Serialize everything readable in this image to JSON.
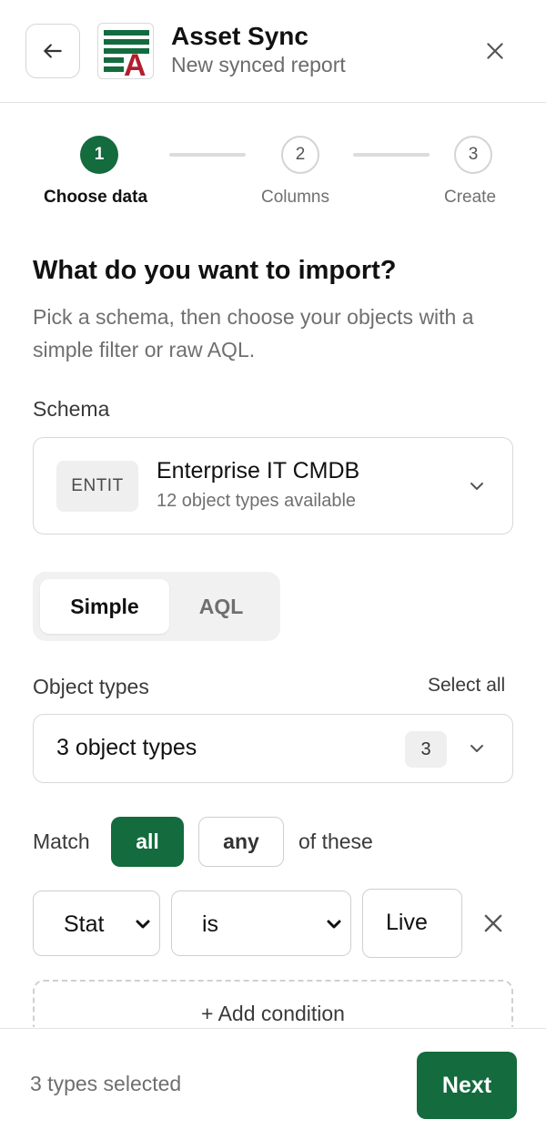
{
  "header": {
    "title": "Asset Sync",
    "subtitle": "New synced report",
    "back_icon": "arrow-left-icon",
    "close_icon": "close-icon",
    "logo_letter": "A"
  },
  "steps": [
    {
      "number": "1",
      "label": "Choose data",
      "state": "active"
    },
    {
      "number": "2",
      "label": "Columns",
      "state": "todo"
    },
    {
      "number": "3",
      "label": "Create",
      "state": "todo"
    }
  ],
  "main": {
    "heading": "What do you want to import?",
    "description": "Pick a schema, then choose your objects with a simple filter or raw AQL."
  },
  "schema": {
    "label": "Schema",
    "badge": "ENTIT",
    "name": "Enterprise IT CMDB",
    "description": "12 object types available"
  },
  "mode": {
    "options": [
      "Simple",
      "AQL"
    ],
    "selected": "Simple"
  },
  "object_types": {
    "label": "Object types",
    "select_all": "Select all",
    "value": "3 object types",
    "count": "3"
  },
  "match": {
    "prefix": "Match",
    "options": [
      "all",
      "any"
    ],
    "selected": "all",
    "suffix": "of these"
  },
  "condition": {
    "field": "Stat",
    "operator": "is",
    "value": "Live"
  },
  "add_condition": "+ Add condition",
  "footer": {
    "status": "3 types selected",
    "next": "Next"
  },
  "colors": {
    "accent": "#136b3e",
    "logo_red": "#b01e2e",
    "logo_green": "#136b3e"
  }
}
